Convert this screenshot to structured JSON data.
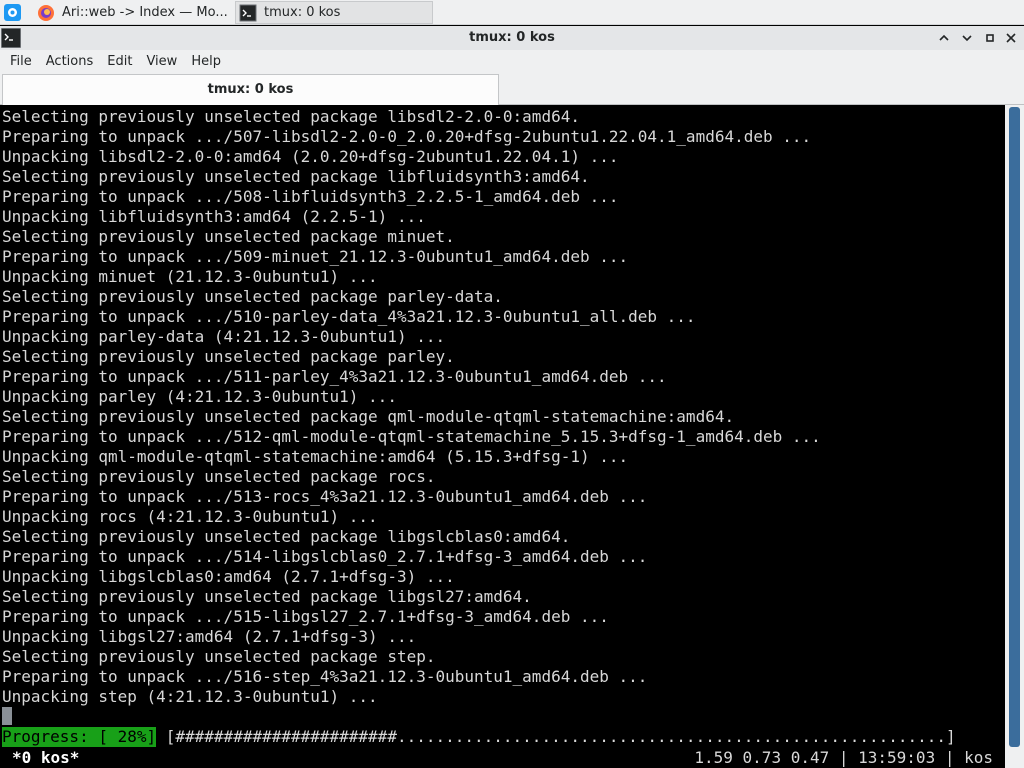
{
  "taskbar": {
    "tasks": [
      {
        "label": "Ari::web -> Index — Mo...",
        "icon": "firefox-icon"
      },
      {
        "label": "tmux: 0 kos",
        "icon": "terminal-icon"
      }
    ]
  },
  "window": {
    "title": "tmux: 0 kos"
  },
  "menu": {
    "file": "File",
    "actions": "Actions",
    "edit": "Edit",
    "view": "View",
    "help": "Help"
  },
  "tab": {
    "label": "tmux: 0 kos"
  },
  "terminal": {
    "lines": [
      "Selecting previously unselected package libsdl2-2.0-0:amd64.",
      "Preparing to unpack .../507-libsdl2-2.0-0_2.0.20+dfsg-2ubuntu1.22.04.1_amd64.deb ...",
      "Unpacking libsdl2-2.0-0:amd64 (2.0.20+dfsg-2ubuntu1.22.04.1) ...",
      "Selecting previously unselected package libfluidsynth3:amd64.",
      "Preparing to unpack .../508-libfluidsynth3_2.2.5-1_amd64.deb ...",
      "Unpacking libfluidsynth3:amd64 (2.2.5-1) ...",
      "Selecting previously unselected package minuet.",
      "Preparing to unpack .../509-minuet_21.12.3-0ubuntu1_amd64.deb ...",
      "Unpacking minuet (21.12.3-0ubuntu1) ...",
      "Selecting previously unselected package parley-data.",
      "Preparing to unpack .../510-parley-data_4%3a21.12.3-0ubuntu1_all.deb ...",
      "Unpacking parley-data (4:21.12.3-0ubuntu1) ...",
      "Selecting previously unselected package parley.",
      "Preparing to unpack .../511-parley_4%3a21.12.3-0ubuntu1_amd64.deb ...",
      "Unpacking parley (4:21.12.3-0ubuntu1) ...",
      "Selecting previously unselected package qml-module-qtqml-statemachine:amd64.",
      "Preparing to unpack .../512-qml-module-qtqml-statemachine_5.15.3+dfsg-1_amd64.deb ...",
      "Unpacking qml-module-qtqml-statemachine:amd64 (5.15.3+dfsg-1) ...",
      "Selecting previously unselected package rocs.",
      "Preparing to unpack .../513-rocs_4%3a21.12.3-0ubuntu1_amd64.deb ...",
      "Unpacking rocs (4:21.12.3-0ubuntu1) ...",
      "Selecting previously unselected package libgslcblas0:amd64.",
      "Preparing to unpack .../514-libgslcblas0_2.7.1+dfsg-3_amd64.deb ...",
      "Unpacking libgslcblas0:amd64 (2.7.1+dfsg-3) ...",
      "Selecting previously unselected package libgsl27:amd64.",
      "Preparing to unpack .../515-libgsl27_2.7.1+dfsg-3_amd64.deb ...",
      "Unpacking libgsl27:amd64 (2.7.1+dfsg-3) ...",
      "Selecting previously unselected package step.",
      "Preparing to unpack .../516-step_4%3a21.12.3-0ubuntu1_amd64.deb ...",
      "Unpacking step (4:21.12.3-0ubuntu1) ..."
    ],
    "progress_label": "Progress: [ 28%]",
    "progress_bar": " [#######################.........................................................] ",
    "progress_percent": 28
  },
  "tmux_status": {
    "window_list": "*0 kos*",
    "right": "1.59 0.73 0.47 | 13:59:03 | kos"
  },
  "colors": {
    "progress_green": "#18a018",
    "scrollbar_thumb": "#3b6d9c"
  }
}
